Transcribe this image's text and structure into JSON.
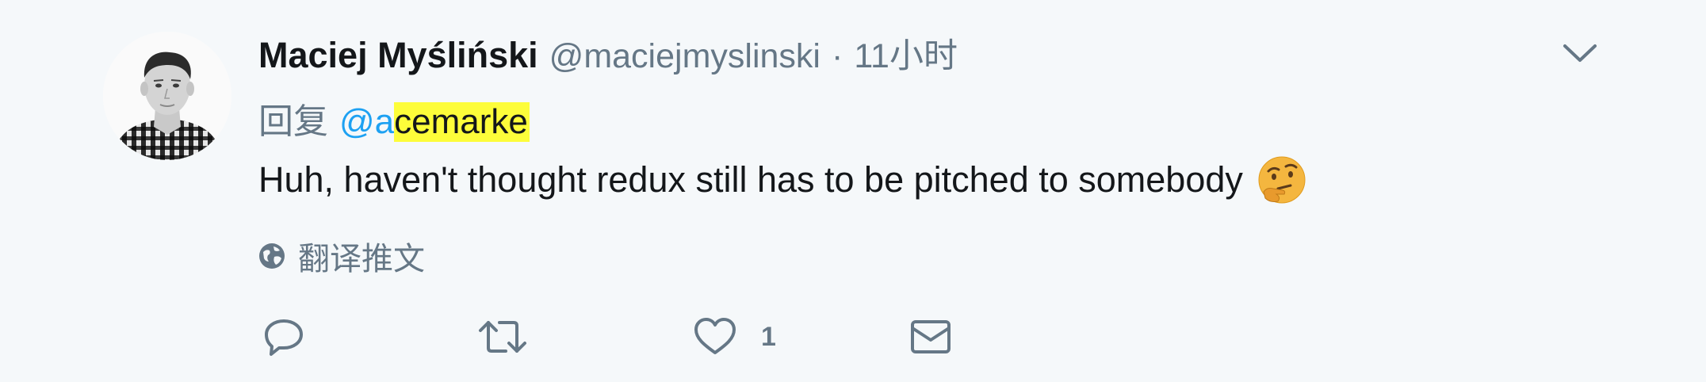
{
  "tweet": {
    "author": {
      "name": "Maciej Myśliński",
      "handle": "@maciejmyslinski",
      "separator": "·",
      "time": "11小时"
    },
    "reply": {
      "prefix": "回复",
      "mention_plain": "@a",
      "mention_highlighted": "cemarke"
    },
    "text": "Huh, haven't thought redux still has to be pitched to somebody",
    "emoji": "thinking-face-icon",
    "translate_label": "翻译推文",
    "actions": {
      "reply_icon": "reply-icon",
      "retweet_icon": "retweet-icon",
      "like_icon": "heart-icon",
      "like_count": "1",
      "dm_icon": "mail-icon"
    },
    "colors": {
      "background": "#f5f8fa",
      "link": "#1da1f2",
      "secondary": "#657786",
      "highlight": "#fdfd3a",
      "primary_text": "#14171a"
    }
  }
}
